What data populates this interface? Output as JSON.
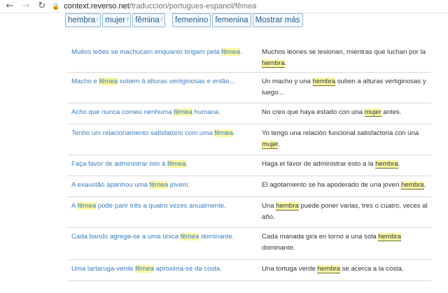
{
  "browser": {
    "url_host": "context.reverso.net",
    "url_path": "/traduccion/portugues-espanol/fêmea"
  },
  "chips": [
    {
      "label": "hembra",
      "tag": "f"
    },
    {
      "label": "mujer",
      "tag": "f"
    },
    {
      "label": "fêmina",
      "tag": "f"
    },
    {
      "label": "femenino",
      "tag": ""
    },
    {
      "label": "femenina",
      "tag": ""
    },
    {
      "label": "Mostrar más",
      "tag": ""
    }
  ],
  "examples": [
    {
      "src": [
        "Muitos leões se machucam enquanto brigam pela ",
        "fêmea",
        "."
      ],
      "trg": [
        "Muchos leones se lesionan, mientras que luchan por la ",
        "hembra",
        "."
      ]
    },
    {
      "src": [
        "Macho e ",
        "fêmea",
        " sobem à alturas vertiginosas e então..."
      ],
      "trg": [
        "Un macho y una ",
        "hembra",
        " suben a alturas vertiginosas y luego..."
      ]
    },
    {
      "src": [
        "Acho que nunca comeu nenhuma ",
        "fêmea",
        " humana."
      ],
      "trg": [
        "No creo que haya estado con una ",
        "mujer",
        " antes."
      ]
    },
    {
      "src": [
        "Tenho um relacionamento satisfatório com uma ",
        "fêmea",
        "."
      ],
      "trg": [
        "Yo tengo una relación funcional satisfactoria con una ",
        "mujer",
        "."
      ]
    },
    {
      "src": [
        "Faça favor de administrar isto à ",
        "fêmea",
        "."
      ],
      "trg": [
        "Haga el favor de administrar esto a la ",
        "hembra",
        "."
      ]
    },
    {
      "src": [
        "A exaustão apanhou uma ",
        "fêmea",
        " jovem."
      ],
      "trg": [
        "El agotamiento se ha apoderado de una joven ",
        "hembra",
        "."
      ]
    },
    {
      "src": [
        "A ",
        "fêmea",
        " pode parir três a quatro vezes anualmente."
      ],
      "trg": [
        "Una ",
        "hembra",
        " puede poner varias, tres o cuatro, veces al año."
      ]
    },
    {
      "src": [
        "Cada bando agrega-se a uma única ",
        "fêmea",
        " dominante."
      ],
      "trg": [
        "Cada manada gira en torno a una sola ",
        "hembra",
        " dominante."
      ]
    },
    {
      "src": [
        "Uma tartaruga-verde ",
        "fêmea",
        " aproxima-se da costa."
      ],
      "trg": [
        "Una tortuga verde ",
        "hembra",
        " se acerca a la costa."
      ]
    }
  ]
}
